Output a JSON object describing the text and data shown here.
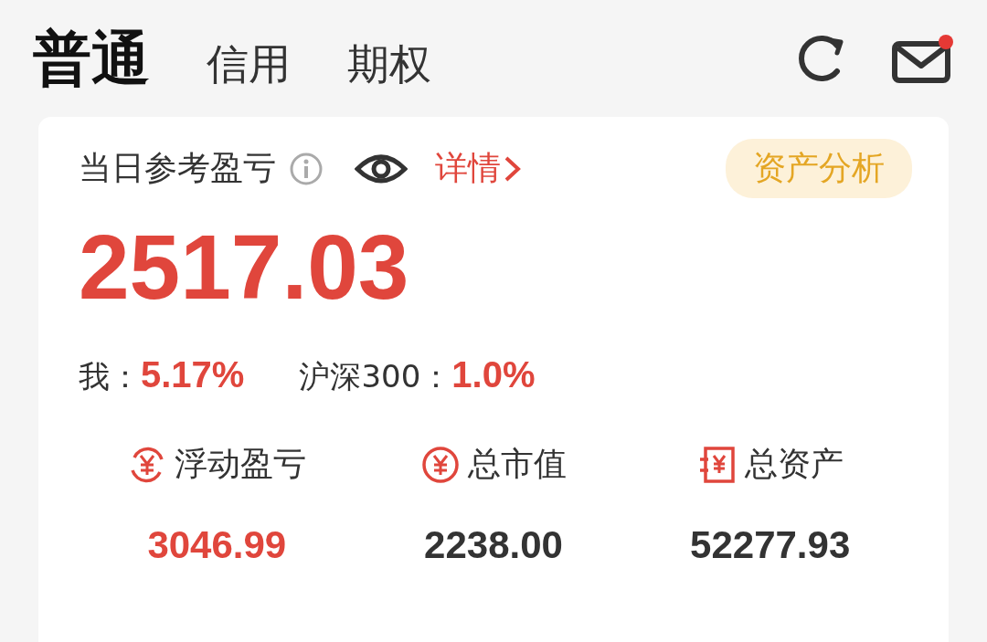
{
  "tabs": [
    {
      "label": "普通",
      "selected": true
    },
    {
      "label": "信用",
      "selected": false
    },
    {
      "label": "期权",
      "selected": false
    }
  ],
  "mail": {
    "unread": true
  },
  "card": {
    "title": "当日参考盈亏",
    "detail_link": "详情",
    "analysis_button": "资产分析",
    "profit": "2517.03",
    "comparisons": [
      {
        "label": "我：",
        "value": "5.17%"
      },
      {
        "label": "沪深300：",
        "value": "1.0%"
      }
    ],
    "stats": [
      {
        "kind": "floating",
        "label": "浮动盈亏",
        "value": "3046.99",
        "color": "#e0463c"
      },
      {
        "kind": "market",
        "label": "总市值",
        "value": "2238.00",
        "color": "#333333"
      },
      {
        "kind": "assets",
        "label": "总资产",
        "value": "52277.93",
        "color": "#333333"
      }
    ]
  }
}
